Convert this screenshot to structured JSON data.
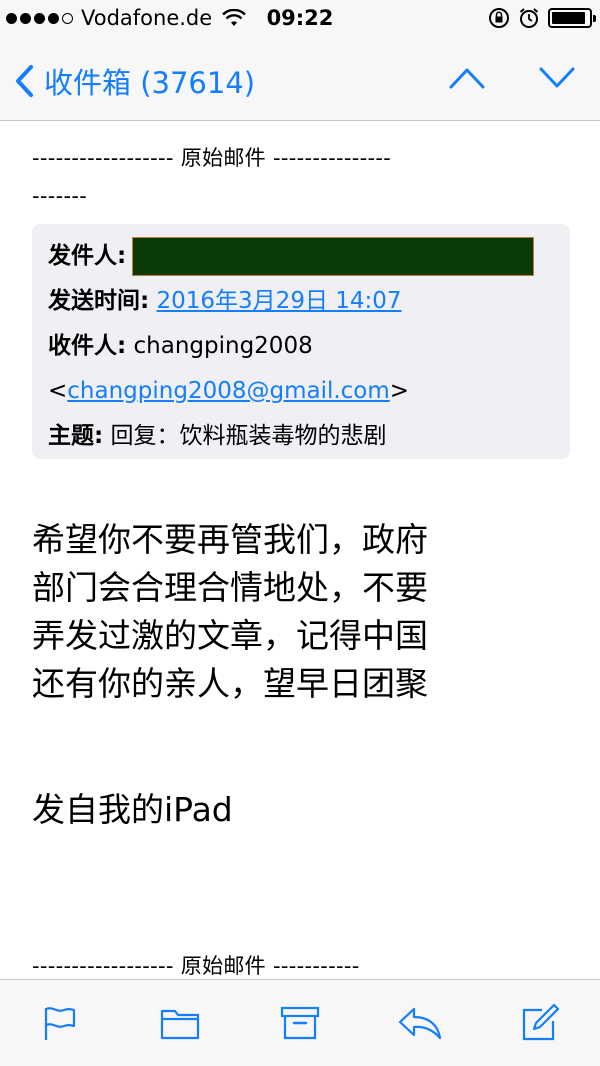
{
  "status_bar": {
    "carrier": "Vodafone.de",
    "time": "09:22",
    "signal_icon": "signal-dots-icon",
    "wifi_icon": "wifi-icon",
    "orientation_lock_icon": "rotation-lock-icon",
    "alarm_icon": "alarm-clock-icon",
    "battery_level": 0.92
  },
  "nav": {
    "back_label": "收件箱 (37614)",
    "accent_color": "#147efb"
  },
  "original_message_label": "------------------ 原始邮件 ---------------",
  "original_message_label_wrap": "-------",
  "header": {
    "from_label": "发件人:",
    "from_value_redacted": true,
    "sent_label": "发送时间:",
    "sent_value": "2016年3月29日 14:07",
    "to_label": "收件人:",
    "to_name": "changping2008",
    "to_email": "changping2008@gmail.com",
    "to_open": "<",
    "to_close": ">",
    "subject_label": "主题:",
    "subject_value": "回复：饮料瓶装毒物的悲剧"
  },
  "body": {
    "lines": [
      "希望你不要再管我们，政府",
      "部门会合理合情地处，不要",
      "弄发过激的文章，记得中国",
      "还有你的亲人，望早日团聚"
    ],
    "signature": "发自我的iPad"
  },
  "bottom_separator": "------------------ 原始邮件 -----------",
  "toolbar": {
    "items": [
      "flag-icon",
      "folder-icon",
      "archive-icon",
      "reply-icon",
      "compose-icon"
    ]
  }
}
